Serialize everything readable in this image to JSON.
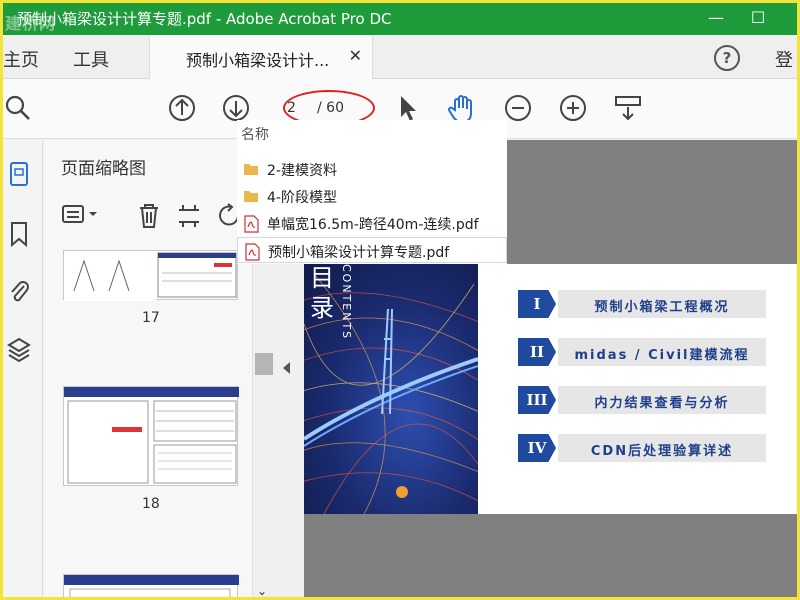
{
  "window": {
    "title": "预制小箱梁设计计算专题.pdf - Adobe Acrobat Pro DC",
    "watermark": "建桥网",
    "minimize": "—",
    "maximize": "☐"
  },
  "menu": {
    "home": "主页",
    "tools": "工具",
    "doc_tab": "预制小箱梁设计计...",
    "close": "✕",
    "help": "?",
    "login": "登"
  },
  "toolbar": {
    "page_current": "2",
    "page_total": "/ 60"
  },
  "panel": {
    "title": "页面缩略图",
    "thumbs": [
      {
        "num": "17"
      },
      {
        "num": "18"
      }
    ]
  },
  "dropdown": {
    "header": "名称",
    "items": [
      {
        "label": "2-建模资料",
        "type": "folder"
      },
      {
        "label": "4-阶段模型",
        "type": "folder"
      },
      {
        "label": "单幅宽16.5m-跨径40m-连续.pdf",
        "type": "pdf"
      },
      {
        "label": "预制小箱梁设计计算专题.pdf",
        "type": "pdf"
      }
    ]
  },
  "page": {
    "cover_mu": "目",
    "cover_lu": "录",
    "cover_contents": "CONTENTS",
    "toc": [
      {
        "num": "I",
        "text": "预制小箱梁工程概况"
      },
      {
        "num": "II",
        "text": "midas / Civil建模流程"
      },
      {
        "num": "III",
        "text": "内力结果查看与分析"
      },
      {
        "num": "IV",
        "text": "CDN后处理验算详述"
      }
    ]
  },
  "colors": {
    "titlebar": "#1e9b3a",
    "accent_blue": "#1f4aa0",
    "annotation_red": "#e02020"
  }
}
